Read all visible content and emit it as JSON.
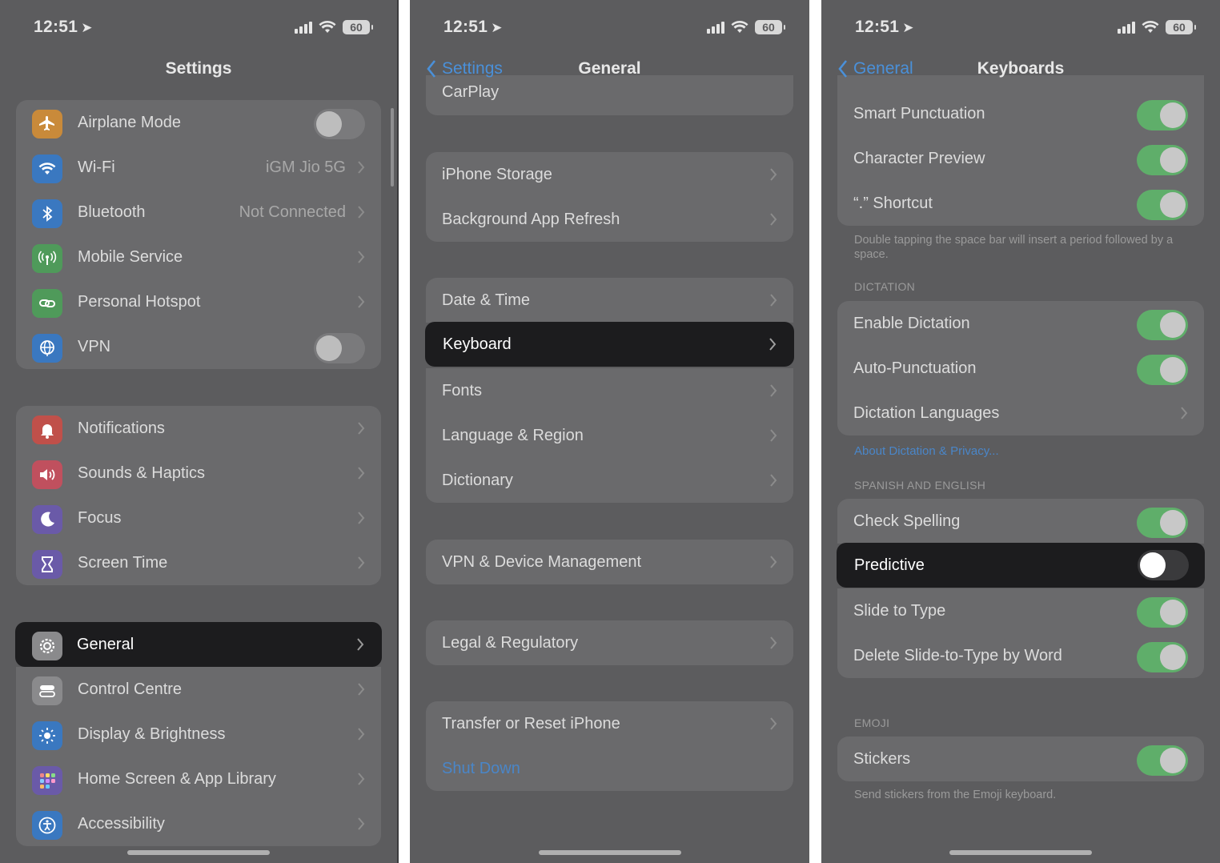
{
  "status": {
    "time": "12:51",
    "battery": "60"
  },
  "panel1": {
    "title": "Settings",
    "group1": [
      {
        "label": "Airplane Mode",
        "control": "toggle",
        "on": false,
        "icon": "airplane-icon",
        "color": "#c98a3a"
      },
      {
        "label": "Wi-Fi",
        "value": "iGM Jio 5G",
        "icon": "wifi-icon",
        "color": "#3a78c0"
      },
      {
        "label": "Bluetooth",
        "value": "Not Connected",
        "icon": "bluetooth-icon",
        "color": "#3a78c0"
      },
      {
        "label": "Mobile Service",
        "icon": "antenna-icon",
        "color": "#4f9a5a"
      },
      {
        "label": "Personal Hotspot",
        "icon": "link-icon",
        "color": "#4f9a5a"
      },
      {
        "label": "VPN",
        "control": "toggle",
        "on": false,
        "icon": "globe-icon",
        "color": "#3a78c0"
      }
    ],
    "group2": [
      {
        "label": "Notifications",
        "icon": "bell-icon",
        "color": "#c0504a"
      },
      {
        "label": "Sounds & Haptics",
        "icon": "speaker-icon",
        "color": "#c0505e"
      },
      {
        "label": "Focus",
        "icon": "moon-icon",
        "color": "#6a5aa8"
      },
      {
        "label": "Screen Time",
        "icon": "hourglass-icon",
        "color": "#6a5aa8"
      }
    ],
    "highlight": {
      "label": "General",
      "icon": "gear-icon"
    },
    "group3": [
      {
        "label": "Control Centre",
        "icon": "switches-icon",
        "color": "#8a8a8c"
      },
      {
        "label": "Display & Brightness",
        "icon": "sun-icon",
        "color": "#3a78c0"
      },
      {
        "label": "Home Screen & App Library",
        "icon": "grid-icon",
        "color": "#6a5aa8"
      },
      {
        "label": "Accessibility",
        "icon": "accessibility-icon",
        "color": "#3a78c0"
      }
    ]
  },
  "panel2": {
    "back": "Settings",
    "title": "General",
    "partial": "CarPlay",
    "groupA": [
      "iPhone Storage",
      "Background App Refresh"
    ],
    "groupB_top": "Date & Time",
    "highlight": "Keyboard",
    "groupB_rest": [
      "Fonts",
      "Language & Region",
      "Dictionary"
    ],
    "groupC": [
      "VPN & Device Management"
    ],
    "groupD": [
      "Legal & Regulatory"
    ],
    "groupE": {
      "item": "Transfer or Reset iPhone",
      "link": "Shut Down"
    }
  },
  "panel3": {
    "back": "General",
    "title": "Keyboards",
    "groupA": [
      {
        "label": "Smart Punctuation",
        "on": true
      },
      {
        "label": "Character Preview",
        "on": true
      },
      {
        "label": "“.” Shortcut",
        "on": true
      }
    ],
    "footA": "Double tapping the space bar will insert a period followed by a space.",
    "dictation_head": "DICTATION",
    "groupB": [
      {
        "label": "Enable Dictation",
        "on": true
      },
      {
        "label": "Auto-Punctuation",
        "on": true
      },
      {
        "label": "Dictation Languages",
        "chevron": true
      }
    ],
    "about_link": "About Dictation & Privacy...",
    "lang_head": "SPANISH AND ENGLISH",
    "groupC_top": {
      "label": "Check Spelling",
      "on": true
    },
    "highlight": {
      "label": "Predictive",
      "on": false
    },
    "groupC_rest": [
      {
        "label": "Slide to Type",
        "on": true
      },
      {
        "label": "Delete Slide-to-Type by Word",
        "on": true
      }
    ],
    "emoji_head": "EMOJI",
    "groupD": [
      {
        "label": "Stickers",
        "on": true
      }
    ],
    "footD": "Send stickers from the Emoji keyboard.",
    "colors": {
      "toggle_on": "#5fae6a",
      "highlight": "#1c1c1e",
      "link": "#4a86c8"
    }
  }
}
